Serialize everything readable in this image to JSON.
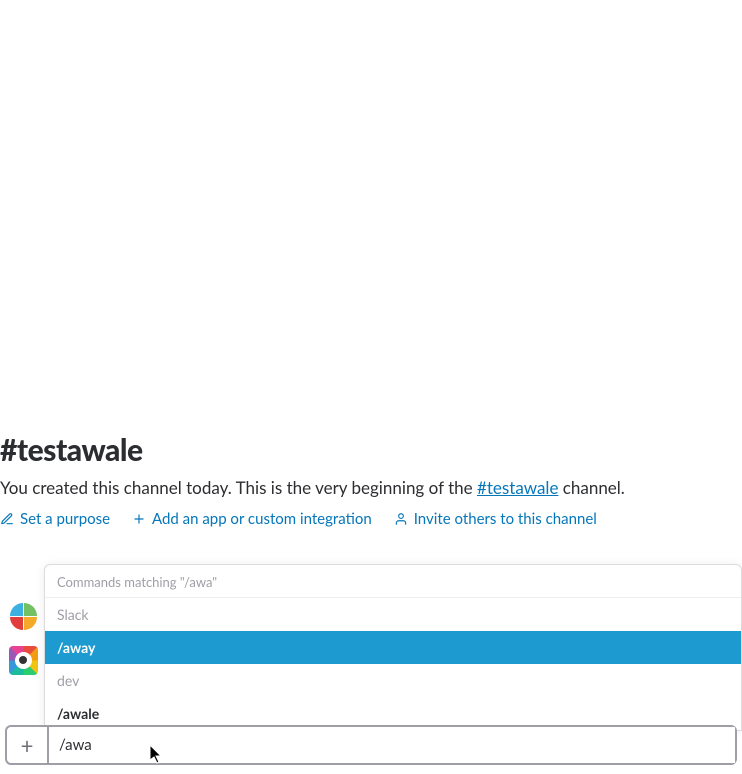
{
  "channel": {
    "title": "#testawale",
    "intro_prefix": "You created this channel today. This is the very beginning of the ",
    "intro_link": "#testawale",
    "intro_suffix": " channel."
  },
  "actions": {
    "set_purpose": "Set a purpose",
    "add_app": "Add an app or custom integration",
    "invite": "Invite others to this channel"
  },
  "autocomplete": {
    "header": "Commands matching \"/awa\"",
    "group1": "Slack",
    "cmd_away": "/away",
    "group2": "dev",
    "cmd_awale": "/awale"
  },
  "input": {
    "value": "/awa"
  },
  "icons": {
    "pencil": "pencil-icon",
    "plus": "plus-icon",
    "person": "person-icon",
    "attach_plus": "+"
  }
}
